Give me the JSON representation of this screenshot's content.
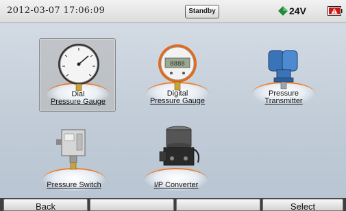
{
  "status": {
    "datetime": "2012-03-07 17:06:09",
    "mode": "Standby",
    "voltage": "24V"
  },
  "tiles": [
    {
      "line1": "Dial",
      "line2": "Pressure Gauge",
      "icon": "dial-gauge-icon",
      "selected": true
    },
    {
      "line1": "Digital",
      "line2": "Pressure Gauge",
      "icon": "digital-gauge-icon",
      "selected": false
    },
    {
      "line1": "Pressure",
      "line2": "Transmitter",
      "icon": "pressure-transmitter-icon",
      "selected": false
    },
    {
      "line1": "",
      "line2": "Pressure Switch",
      "icon": "pressure-switch-icon",
      "selected": false
    },
    {
      "line1": "",
      "line2": "I/P Converter",
      "icon": "ip-converter-icon",
      "selected": false
    }
  ],
  "softkeys": [
    "Back",
    "",
    "",
    "Select"
  ],
  "colors": {
    "accent_orange": "#f07a22",
    "background": "#c5d0dc",
    "voltage_diamond": "#1f8a3a",
    "battery_alert": "#d01818"
  }
}
